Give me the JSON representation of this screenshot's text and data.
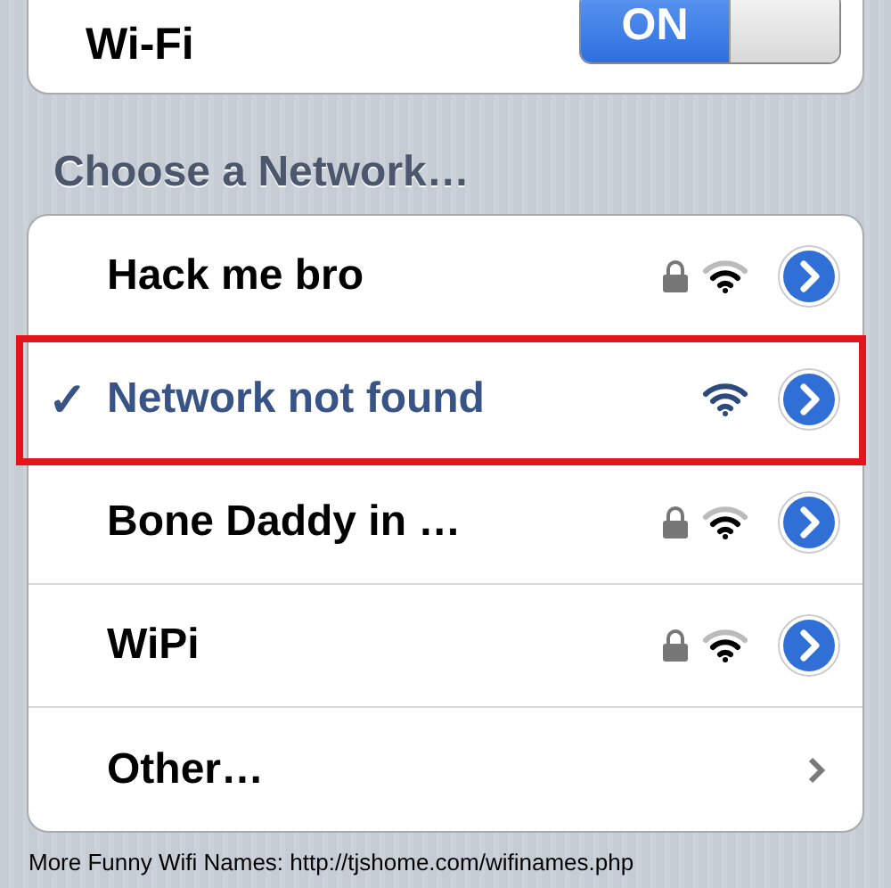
{
  "wifi": {
    "label": "Wi-Fi",
    "toggle": {
      "on": true,
      "text": "ON"
    }
  },
  "section_header": "Choose a Network…",
  "networks": [
    {
      "kind": "network",
      "name": "Hack me bro",
      "selected": false,
      "locked": true,
      "highlighted": false
    },
    {
      "kind": "network",
      "name": "Network not found",
      "selected": true,
      "locked": false,
      "highlighted": true,
      "check": "✓"
    },
    {
      "kind": "network",
      "name": "Bone Daddy in …",
      "selected": false,
      "locked": true,
      "highlighted": false
    },
    {
      "kind": "network",
      "name": "WiPi",
      "selected": false,
      "locked": true,
      "highlighted": false
    },
    {
      "kind": "other",
      "name": "Other…"
    }
  ],
  "caption": "More Funny Wifi Names: http://tjshome.com/wifinames.php"
}
